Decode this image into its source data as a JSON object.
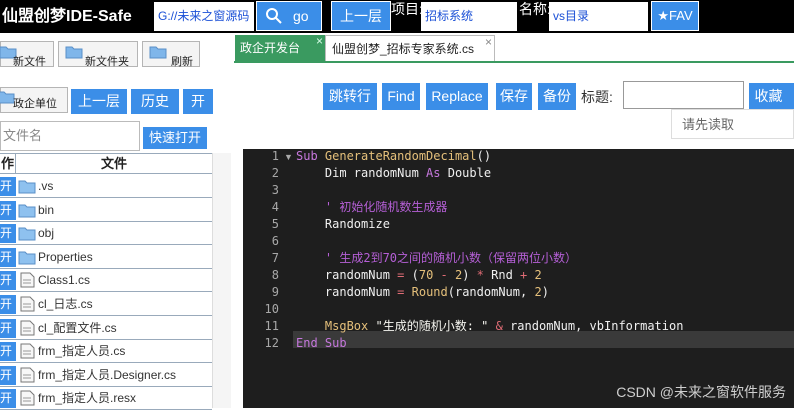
{
  "app": {
    "title": "仙盟创梦IDE-Safe"
  },
  "header": {
    "path_value": "G://未来之窗源码",
    "go_label": "go",
    "up_label": "上一层",
    "project_label": "项目:",
    "project_value": "招标系统",
    "name_label": "名称:",
    "name_value": "vs目录",
    "fav_label": "★FAV"
  },
  "left": {
    "new_file": "新文件",
    "new_folder": "新文件夹",
    "refresh": "刷新",
    "gov_unit": "政企单位",
    "up": "上一层",
    "history": "历史",
    "open": "开",
    "search_placeholder": "文件名",
    "quick_open": "快速打开",
    "col_action": "作",
    "col_file": "文件",
    "open_label": "开",
    "files": [
      {
        "name": ".vs",
        "type": "folder"
      },
      {
        "name": "bin",
        "type": "folder"
      },
      {
        "name": "obj",
        "type": "folder"
      },
      {
        "name": "Properties",
        "type": "folder"
      },
      {
        "name": "Class1.cs",
        "type": "file"
      },
      {
        "name": "cl_日志.cs",
        "type": "file"
      },
      {
        "name": "cl_配置文件.cs",
        "type": "file"
      },
      {
        "name": "frm_指定人员.cs",
        "type": "file"
      },
      {
        "name": "frm_指定人员.Designer.cs",
        "type": "file"
      },
      {
        "name": "frm_指定人员.resx",
        "type": "file"
      }
    ]
  },
  "tabs": {
    "tab1": "政企开发台",
    "tab2": "仙盟创梦_招标专家系统.cs",
    "close": "×"
  },
  "toolbar": {
    "jump": "跳转行",
    "find": "Find",
    "replace": "Replace",
    "save": "保存",
    "backup": "备份",
    "title_label": "标题:",
    "collect": "收藏",
    "read_first": "请先读取"
  },
  "editor": {
    "line_numbers": [
      "1",
      "2",
      "3",
      "4",
      "5",
      "6",
      "7",
      "8",
      "9",
      "10",
      "11",
      "12"
    ],
    "lines": {
      "l1_kw": "Sub ",
      "l1_fn": "GenerateRandomDecimal",
      "l1_rest": "()",
      "l2_a": "    Dim randomNum ",
      "l2_kw": "As",
      "l2_b": " Double",
      "l4": "    ' 初始化随机数生成器",
      "l5": "    Randomize",
      "l7": "    ' 生成2到70之间的随机小数（保留两位小数）",
      "l8_a": "    randomNum ",
      "l8_op1": "=",
      "l8_b": " (",
      "l8_n1": "70",
      "l8_op2": " - ",
      "l8_n2": "2",
      "l8_c": ") ",
      "l8_op3": "*",
      "l8_d": " Rnd ",
      "l8_op4": "+",
      "l8_n3": " 2",
      "l9_a": "    randomNum ",
      "l9_op": "=",
      "l9_fn": " Round",
      "l9_b": "(randomNum, ",
      "l9_n": "2",
      "l9_c": ")",
      "l11_fn": "    MsgBox",
      "l11_str": " \"生成的随机小数: \" ",
      "l11_op": "&",
      "l11_rest": " randomNum, vbInformation",
      "l12": "End Sub"
    },
    "watermark": "CSDN @未来之窗软件服务"
  },
  "colors": {
    "accent_blue": "#3b8ee8",
    "tab_green": "#3a9a60",
    "editor_bg": "#1e1e1e",
    "topbar_bg": "#000000"
  },
  "icons": [
    "search-icon",
    "folder-icon",
    "file-icon"
  ]
}
